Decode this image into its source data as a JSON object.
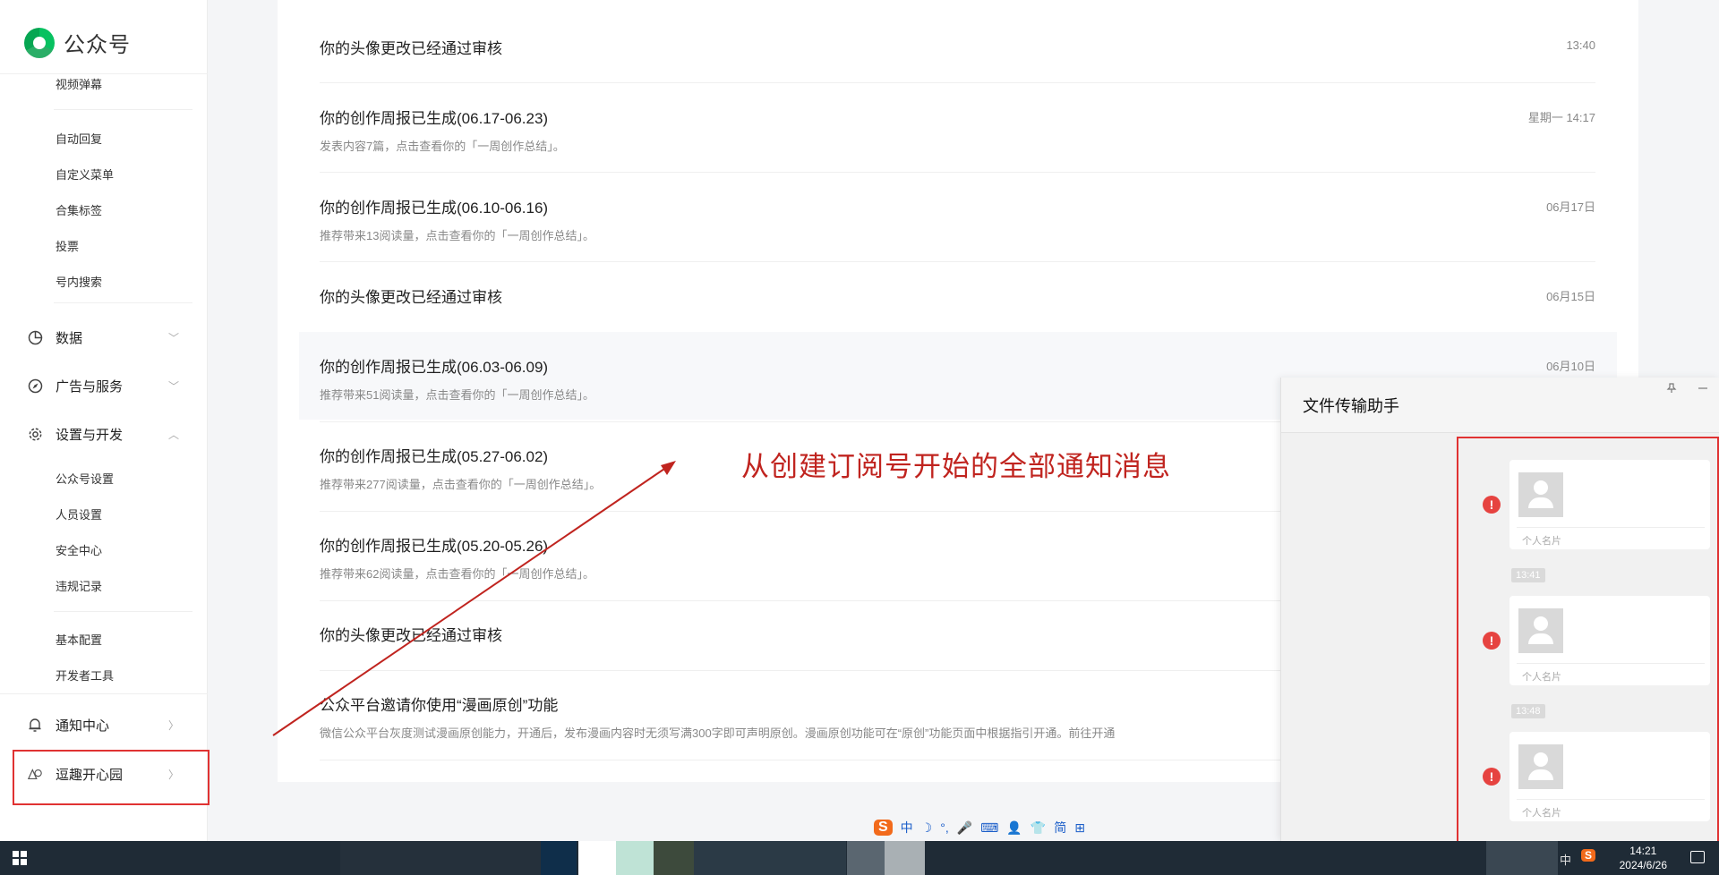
{
  "app": {
    "logo_text": "公众号"
  },
  "sidebar": {
    "sub_items_top": [
      "视频弹幕",
      "自动回复",
      "自定义菜单",
      "合集标签",
      "投票",
      "号内搜索"
    ],
    "groups": [
      {
        "label": "数据",
        "icon": "chart-pie-icon",
        "expanded": false
      },
      {
        "label": "广告与服务",
        "icon": "compass-icon",
        "expanded": false
      },
      {
        "label": "设置与开发",
        "icon": "gear-icon",
        "expanded": true
      }
    ],
    "settings_items": [
      "公众号设置",
      "人员设置",
      "安全中心",
      "违规记录"
    ],
    "dev_items": [
      "基本配置",
      "开发者工具"
    ],
    "notice_center": "通知中心",
    "fun_park": "逗趣开心园"
  },
  "notices": [
    {
      "title": "你的头像更改已经通过审核",
      "desc": "",
      "time": "13:40"
    },
    {
      "title": "你的创作周报已生成(06.17-06.23)",
      "desc": "发表内容7篇，点击查看你的「一周创作总结」。",
      "time": "星期一 14:17"
    },
    {
      "title": "你的创作周报已生成(06.10-06.16)",
      "desc": "推荐带来13阅读量，点击查看你的「一周创作总结」。",
      "time": "06月17日"
    },
    {
      "title": "你的头像更改已经通过审核",
      "desc": "",
      "time": "06月15日"
    },
    {
      "title": "你的创作周报已生成(06.03-06.09)",
      "desc": "推荐带来51阅读量，点击查看你的「一周创作总结」。",
      "time": "06月10日"
    },
    {
      "title": "你的创作周报已生成(05.27-06.02)",
      "desc": "推荐带来277阅读量，点击查看你的「一周创作总结」。",
      "time": ""
    },
    {
      "title": "你的创作周报已生成(05.20-05.26)",
      "desc": "推荐带来62阅读量，点击查看你的「一周创作总结」。",
      "time": ""
    },
    {
      "title": "你的头像更改已经通过审核",
      "desc": "",
      "time": ""
    },
    {
      "title": "公众平台邀请你使用“漫画原创”功能",
      "desc": "微信公众平台灰度测试漫画原创能力，开通后，发布漫画内容时无须写满300字即可声明原创。漫画原创功能可在“原创”功能页面中根据指引开通。前往开通",
      "time": ""
    }
  ],
  "annotation": {
    "text": "从创建订阅号开始的全部通知消息",
    "color": "#c0241f"
  },
  "chat": {
    "title": "文件传输助手",
    "pin_icon": "pin-icon",
    "minimize_icon": "minimize-icon",
    "messages": [
      {
        "card_label": "个人名片",
        "status": "send-failed"
      },
      {
        "card_label": "个人名片",
        "status": "send-failed"
      },
      {
        "card_label": "个人名片",
        "status": "send-failed"
      }
    ],
    "timestamps": [
      "13:41",
      "13:48"
    ],
    "error_glyph": "!"
  },
  "ime": {
    "logo": "S",
    "items": [
      "中",
      "☽",
      "°,",
      "🎤",
      "⌨",
      "👤",
      "👕",
      "简",
      "⊞"
    ]
  },
  "taskbar": {
    "time": "14:21",
    "date": "2024/6/26",
    "ime_indicator": "中"
  },
  "colors": {
    "accent_red": "#e03232",
    "brand_green": "#07c160",
    "error_red": "#e64340"
  }
}
